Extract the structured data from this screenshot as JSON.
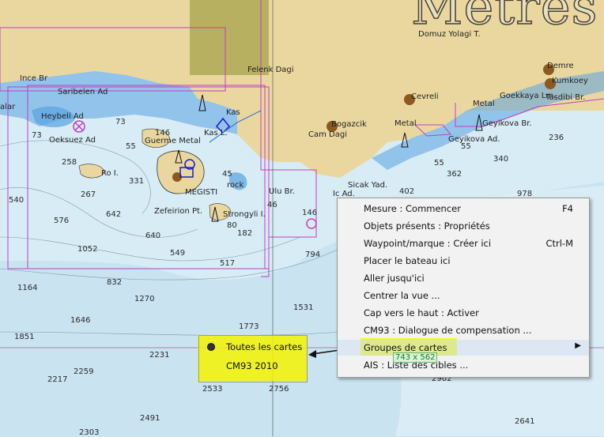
{
  "title_overlay": "Metres",
  "map_labels": {
    "domuz_yolagi": "Domuz Yolagi T.",
    "demre": "Demre",
    "kumkoey": "Kumkoey",
    "goekkaya": "Goekkaya Lm.",
    "tasdibi": "Tasdibi Br.",
    "metal_top": "Metal",
    "felenk": "Felenk Dagi",
    "ince_br": "Ince Br",
    "saribelen": "Saribelen Ad",
    "heybeli": "Heybeli Ad",
    "kas": "Kas",
    "kas_l": "Kas L.",
    "cevreli": "Cevreli",
    "bogazcik": "Bogazcik",
    "cam_dagi": "Cam Dagi",
    "metal_mid": "Metal",
    "geyikova_br": "Geyikova Br.",
    "geyikova_ad": "Geyikova Ad.",
    "oeksuez": "Oeksuez Ad",
    "guerme": "Guerme Metal",
    "ro_i": "Ro I.",
    "megisti": "MEGISTI",
    "rock": "rock",
    "zefeirion": "Zefeirion Pt.",
    "strongyli": "Strongyli I.",
    "ulu_br": "Ulu Br.",
    "ic_ad": "Ic Ad.",
    "sicak_yad": "Sicak Yad.",
    "alar": "alar"
  },
  "depths": [
    "73",
    "73",
    "146",
    "55",
    "258",
    "267",
    "331",
    "540",
    "576",
    "642",
    "640",
    "549",
    "1052",
    "1164",
    "832",
    "1270",
    "1646",
    "1851",
    "517",
    "182",
    "794",
    "1531",
    "1773",
    "2231",
    "2217",
    "2259",
    "2533",
    "2756",
    "2491",
    "2303",
    "2902",
    "2641",
    "402",
    "978",
    "362",
    "340",
    "236",
    "55",
    "146",
    "45",
    "80",
    "46",
    "55"
  ],
  "context_menu": {
    "items": [
      {
        "label": "Mesure : Commencer",
        "shortcut": "F4"
      },
      {
        "label": "Objets présents : Propriétés",
        "shortcut": ""
      },
      {
        "label": "Waypoint/marque : Créer ici",
        "shortcut": "Ctrl-M"
      },
      {
        "label": "Placer le bateau ici",
        "shortcut": ""
      },
      {
        "label": "Aller jusqu'ici",
        "shortcut": ""
      },
      {
        "label": "Centrer la vue ...",
        "shortcut": ""
      },
      {
        "label": "Cap vers le haut : Activer",
        "shortcut": ""
      },
      {
        "label": "CM93 : Dialogue de compensation ...",
        "shortcut": ""
      },
      {
        "label": "Groupes de cartes",
        "shortcut": "",
        "has_submenu": true
      },
      {
        "label": "AIS : Liste des cibles ...",
        "shortcut": ""
      }
    ]
  },
  "submenu": {
    "items": [
      {
        "label": "Toutes les cartes",
        "selected": true
      },
      {
        "label": "CM93 2010",
        "selected": false
      }
    ]
  },
  "size_tag": "743 x 562",
  "colors": {
    "sea_deep": "#c9e3f0",
    "sea_shallow": "#5aa2e0",
    "land": "#ead7a0",
    "land_dark": "#b7b060",
    "chart_border": "#c040c0",
    "highlight": "#f4f400",
    "menu_bg": "#f2f2f2"
  }
}
